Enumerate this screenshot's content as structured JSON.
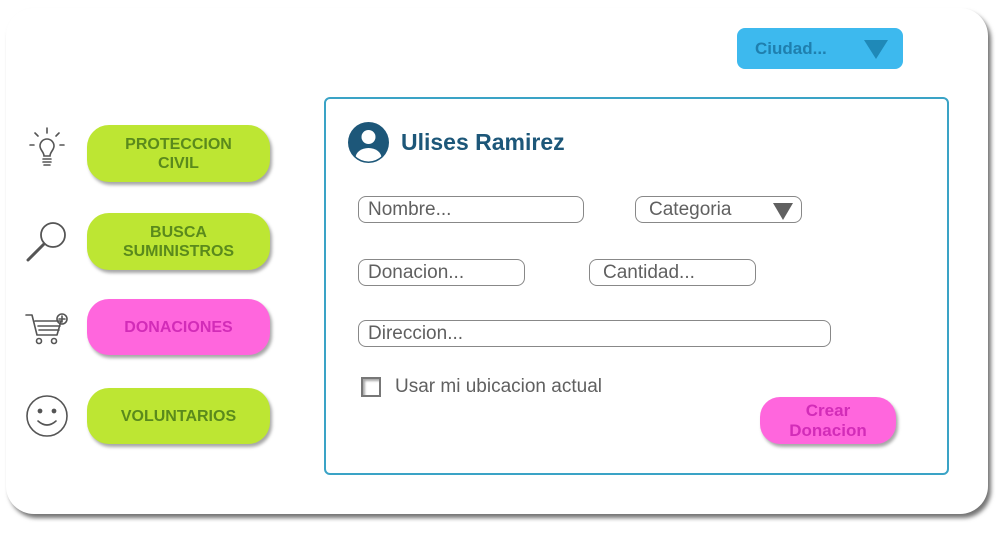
{
  "city_select": {
    "value": "Ciudad..."
  },
  "nav": {
    "proteccion_civil": {
      "line1": "PROTECCION",
      "line2": "CIVIL"
    },
    "busca_suministros": {
      "line1": "BUSCA",
      "line2": "SUMINISTROS"
    },
    "donaciones": "DONACIONES",
    "voluntarios": "VOLUNTARIOS"
  },
  "icons": {
    "proteccion_civil": "lightbulb-icon",
    "busca_suministros": "magnifier-icon",
    "donaciones": "cart-add-icon",
    "voluntarios": "smiley-icon",
    "user": "user-avatar-icon"
  },
  "form": {
    "user_name": "Ulises Ramirez",
    "nombre_placeholder": "Nombre...",
    "categoria_value": "Categoria",
    "donacion_placeholder": "Donacion...",
    "cantidad_placeholder": "Cantidad...",
    "direccion_placeholder": "Direccion...",
    "use_location_label": "Usar mi ubicacion actual",
    "use_location_checked": false,
    "create_button": {
      "line1": "Crear",
      "line2": "Donacion"
    }
  },
  "colors": {
    "green_button": "#bde633",
    "pink_button": "#ff66dd",
    "city_button": "#3db9ee",
    "panel_border": "#3aa3c6",
    "user_name": "#1d5779"
  }
}
